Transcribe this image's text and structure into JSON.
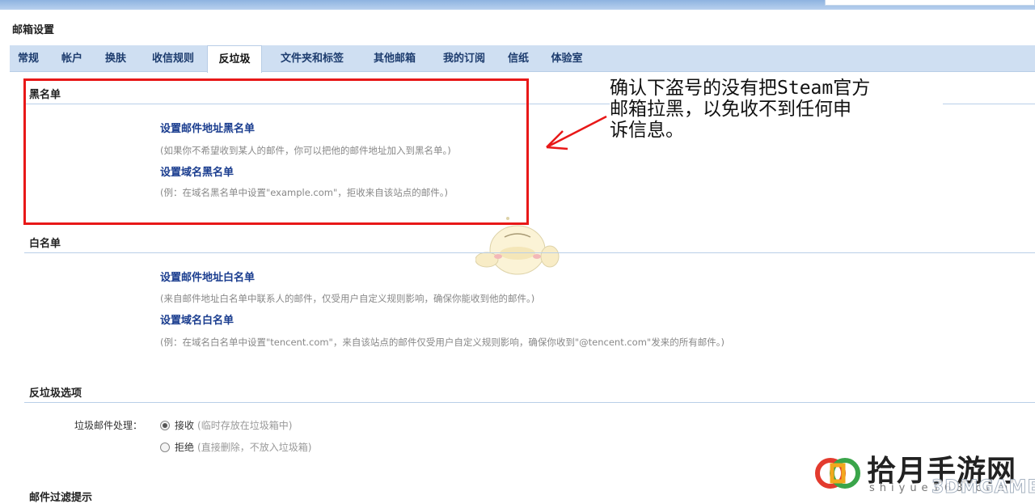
{
  "header": {
    "title": "邮箱设置"
  },
  "tabs": [
    {
      "label": "常规"
    },
    {
      "label": "帐户"
    },
    {
      "label": "换肤"
    },
    {
      "label": "收信规则"
    },
    {
      "label": "反垃圾",
      "active": true
    },
    {
      "label": "文件夹和标签"
    },
    {
      "label": "其他邮箱"
    },
    {
      "label": "我的订阅"
    },
    {
      "label": "信纸"
    },
    {
      "label": "体验室"
    }
  ],
  "blacklist": {
    "title": "黑名单",
    "email_link": "设置邮件地址黑名单",
    "email_desc": "(如果你不希望收到某人的邮件，你可以把他的邮件地址加入到黑名单。)",
    "domain_link": "设置域名黑名单",
    "domain_desc": "(例：在域名黑名单中设置\"example.com\"，拒收来自该站点的邮件。)"
  },
  "whitelist": {
    "title": "白名单",
    "email_link": "设置邮件地址白名单",
    "email_desc": "(来自邮件地址白名单中联系人的邮件，仅受用户自定义规则影响，确保你能收到他的邮件。)",
    "domain_link": "设置域名白名单",
    "domain_desc": "(例：在域名白名单中设置\"tencent.com\"，来自该站点的邮件仅受用户自定义规则影响，确保你收到\"@tencent.com\"发来的所有邮件。)"
  },
  "antispam": {
    "title": "反垃圾选项",
    "label": "垃圾邮件处理：",
    "options": [
      {
        "label": "接收",
        "hint": "(临时存放在垃圾箱中)",
        "checked": true
      },
      {
        "label": "拒绝",
        "hint": "(直接删除，不放入垃圾箱)",
        "checked": false
      }
    ]
  },
  "filter": {
    "title": "邮件过滤提示"
  },
  "annotation": {
    "lines": [
      "确认下盗号的没有把Steam官方",
      "邮箱拉黑，以免收不到任何申",
      "诉信息。"
    ],
    "color": "#e81818"
  },
  "watermark": {
    "brand": "拾月手游网",
    "domain": "shiyue168.com",
    "overlay": "3DMGAME"
  },
  "icons": {
    "arrow": "red-arrow-icon",
    "mascot": "duck-mascot-icon",
    "logo": "brand-logo-icon"
  }
}
